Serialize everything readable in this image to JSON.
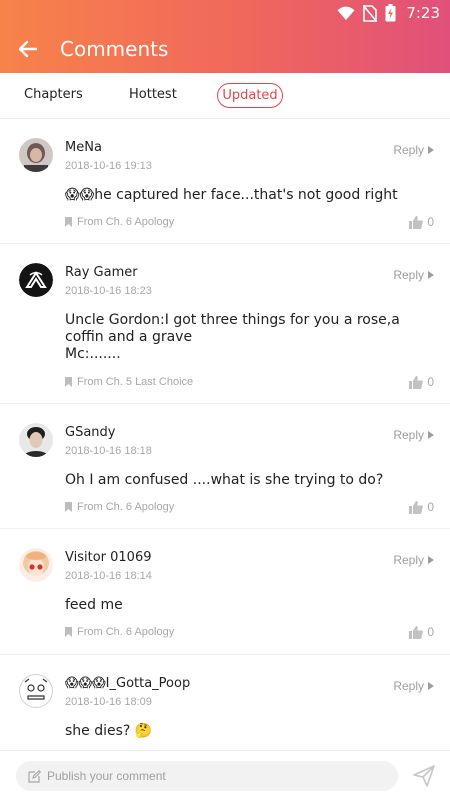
{
  "status_bar": {
    "time": "7:23"
  },
  "header": {
    "title": "Comments"
  },
  "tabs": [
    {
      "label": "Chapters"
    },
    {
      "label": "Hottest"
    },
    {
      "label": "Updated"
    }
  ],
  "reply_label": "Reply",
  "comments": [
    {
      "user": "MeNa",
      "date": "2018-10-16 19:13",
      "text": "😱😱he captured her face...that's not good right",
      "source": "From Ch. 6 Apology",
      "likes": "0"
    },
    {
      "user": "Ray Gamer",
      "date": "2018-10-16 18:23",
      "text": "Uncle Gordon:I got three things for you a rose,a coffin and a grave\nMc:.......",
      "source": "From Ch. 5 Last Choice",
      "likes": "0"
    },
    {
      "user": "GSandy",
      "date": "2018-10-16 18:18",
      "text": "Oh I am confused ....what is she trying to do?",
      "source": "From Ch. 6 Apology",
      "likes": "0"
    },
    {
      "user": "Visitor 01069",
      "date": "2018-10-16 18:14",
      "text": "feed me",
      "source": "From Ch. 6 Apology",
      "likes": "0"
    },
    {
      "user": "😱😱😱I_Gotta_Poop",
      "date": "2018-10-16 18:09",
      "text": "she dies? 🤔",
      "source": "",
      "likes": ""
    }
  ],
  "composer": {
    "placeholder": "Publish your comment"
  },
  "colors": {
    "accent": "#e9444a",
    "header_start": "#f7834a",
    "header_end": "#e1507a"
  },
  "icons": [
    "wifi-icon",
    "no-sim-icon",
    "battery-icon",
    "back-arrow-icon",
    "chevron-right-icon",
    "bookmark-icon",
    "thumbs-up-icon",
    "edit-icon",
    "send-icon"
  ]
}
